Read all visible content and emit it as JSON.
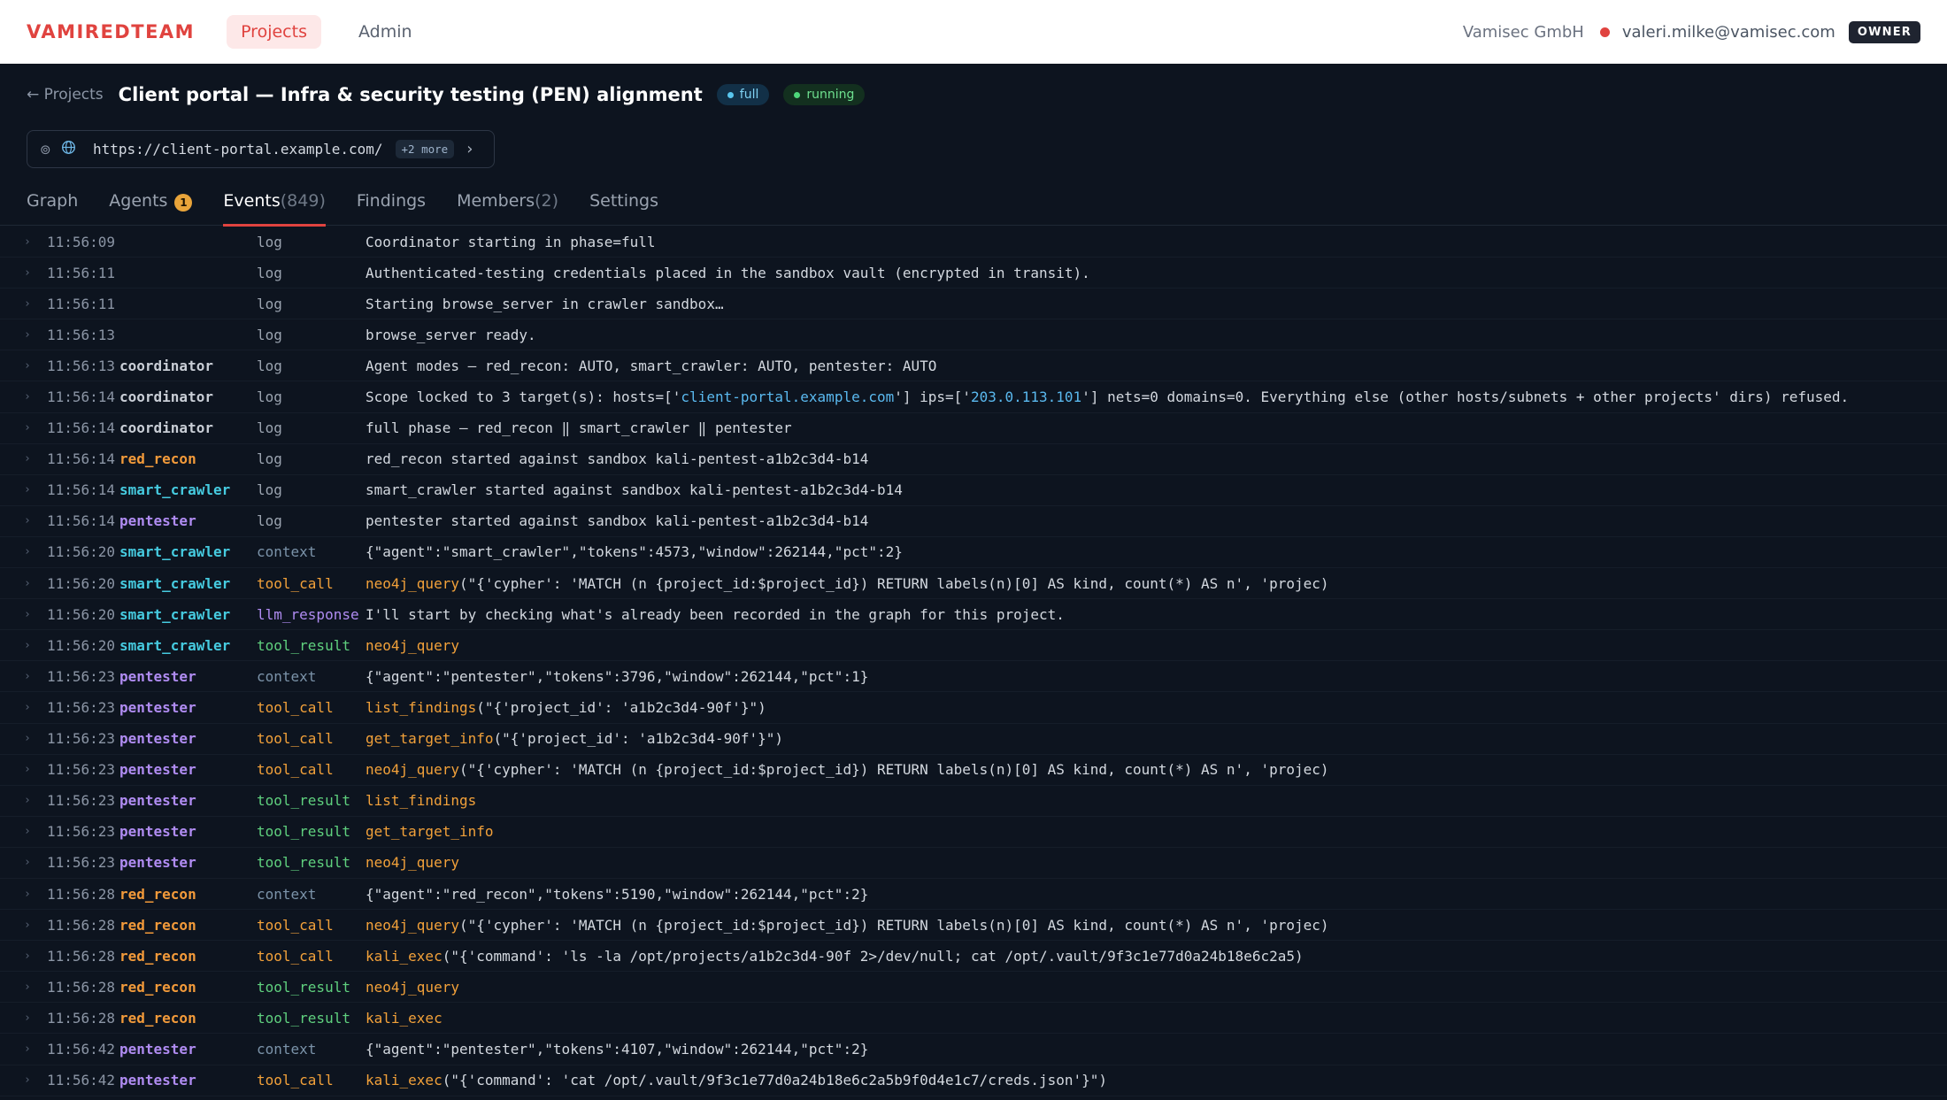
{
  "nav": {
    "brand": "VAMIREDTEAM",
    "projects": "Projects",
    "admin": "Admin",
    "org": "Vamisec GmbH",
    "email": "valeri.milke@vamisec.com",
    "role": "OWNER"
  },
  "header": {
    "back": "← Projects",
    "title": "Client portal — Infra & security testing (PEN) alignment",
    "phase_badge": "full",
    "status_badge": "running"
  },
  "target": {
    "url": "https://client-portal.example.com/",
    "more": "+2 more",
    "chevron": "›"
  },
  "tabs": {
    "graph": "Graph",
    "agents": "Agents",
    "agents_badge": "1",
    "events": "Events",
    "events_count": "(849)",
    "findings": "Findings",
    "members": "Members",
    "members_count": "(2)",
    "settings": "Settings"
  },
  "colors": {
    "accent": "#e0433f",
    "red_recon": "#f29a3a",
    "smart_crawler": "#46cbe0",
    "pentester": "#b08cf2"
  },
  "events": [
    {
      "time": "11:56:09",
      "agent": "",
      "type": "log",
      "msg": "Coordinator starting in phase=full"
    },
    {
      "time": "11:56:11",
      "agent": "",
      "type": "log",
      "msg": "Authenticated-testing credentials placed in the sandbox vault (encrypted in transit)."
    },
    {
      "time": "11:56:11",
      "agent": "",
      "type": "log",
      "msg": "Starting browse_server in crawler sandbox…"
    },
    {
      "time": "11:56:13",
      "agent": "",
      "type": "log",
      "msg": "browse_server ready."
    },
    {
      "time": "11:56:13",
      "agent": "coordinator",
      "type": "log",
      "msg": "Agent modes — red_recon: AUTO, smart_crawler: AUTO, pentester: AUTO"
    },
    {
      "time": "11:56:14",
      "agent": "coordinator",
      "type": "log",
      "msg_parts": [
        "Scope locked to 3 target(s): hosts=['",
        "client-portal.example.com",
        "'] ips=['",
        "203.0.113.101",
        "'] nets=0 domains=0. Everything else (other hosts/subnets + other projects' dirs) refused."
      ]
    },
    {
      "time": "11:56:14",
      "agent": "coordinator",
      "type": "log",
      "msg": "full phase — red_recon ‖ smart_crawler ‖ pentester"
    },
    {
      "time": "11:56:14",
      "agent": "red_recon",
      "type": "log",
      "msg": "red_recon started against sandbox kali-pentest-a1b2c3d4-b14"
    },
    {
      "time": "11:56:14",
      "agent": "smart_crawler",
      "type": "log",
      "msg": "smart_crawler started against sandbox kali-pentest-a1b2c3d4-b14"
    },
    {
      "time": "11:56:14",
      "agent": "pentester",
      "type": "log",
      "msg": "pentester started against sandbox kali-pentest-a1b2c3d4-b14"
    },
    {
      "time": "11:56:20",
      "agent": "smart_crawler",
      "type": "context",
      "msg": "{\"agent\":\"smart_crawler\",\"tokens\":4573,\"window\":262144,\"pct\":2}"
    },
    {
      "time": "11:56:20",
      "agent": "smart_crawler",
      "type": "tool_call",
      "fn": "neo4j_query",
      "args": "(\"{'cypher': 'MATCH (n {project_id:$project_id}) RETURN labels(n)[0] AS kind, count(*) AS n', 'projec)"
    },
    {
      "time": "11:56:20",
      "agent": "smart_crawler",
      "type": "llm_response",
      "msg": "I'll start by checking what's already been recorded in the graph for this project."
    },
    {
      "time": "11:56:20",
      "agent": "smart_crawler",
      "type": "tool_result",
      "fn": "neo4j_query",
      "args": ""
    },
    {
      "time": "11:56:23",
      "agent": "pentester",
      "type": "context",
      "msg": "{\"agent\":\"pentester\",\"tokens\":3796,\"window\":262144,\"pct\":1}"
    },
    {
      "time": "11:56:23",
      "agent": "pentester",
      "type": "tool_call",
      "fn": "list_findings",
      "args": "(\"{'project_id': 'a1b2c3d4-90f'}\")"
    },
    {
      "time": "11:56:23",
      "agent": "pentester",
      "type": "tool_call",
      "fn": "get_target_info",
      "args": "(\"{'project_id': 'a1b2c3d4-90f'}\")"
    },
    {
      "time": "11:56:23",
      "agent": "pentester",
      "type": "tool_call",
      "fn": "neo4j_query",
      "args": "(\"{'cypher': 'MATCH (n {project_id:$project_id}) RETURN labels(n)[0] AS kind, count(*) AS n', 'projec)"
    },
    {
      "time": "11:56:23",
      "agent": "pentester",
      "type": "tool_result",
      "fn": "list_findings",
      "args": ""
    },
    {
      "time": "11:56:23",
      "agent": "pentester",
      "type": "tool_result",
      "fn": "get_target_info",
      "args": ""
    },
    {
      "time": "11:56:23",
      "agent": "pentester",
      "type": "tool_result",
      "fn": "neo4j_query",
      "args": ""
    },
    {
      "time": "11:56:28",
      "agent": "red_recon",
      "type": "context",
      "msg": "{\"agent\":\"red_recon\",\"tokens\":5190,\"window\":262144,\"pct\":2}"
    },
    {
      "time": "11:56:28",
      "agent": "red_recon",
      "type": "tool_call",
      "fn": "neo4j_query",
      "args": "(\"{'cypher': 'MATCH (n {project_id:$project_id}) RETURN labels(n)[0] AS kind, count(*) AS n', 'projec)"
    },
    {
      "time": "11:56:28",
      "agent": "red_recon",
      "type": "tool_call",
      "fn": "kali_exec",
      "args": "(\"{'command': 'ls -la /opt/projects/a1b2c3d4-90f 2>/dev/null; cat /opt/.vault/9f3c1e77d0a24b18e6c2a5)"
    },
    {
      "time": "11:56:28",
      "agent": "red_recon",
      "type": "tool_result",
      "fn": "neo4j_query",
      "args": ""
    },
    {
      "time": "11:56:28",
      "agent": "red_recon",
      "type": "tool_result",
      "fn": "kali_exec",
      "args": ""
    },
    {
      "time": "11:56:42",
      "agent": "pentester",
      "type": "context",
      "msg": "{\"agent\":\"pentester\",\"tokens\":4107,\"window\":262144,\"pct\":2}"
    },
    {
      "time": "11:56:42",
      "agent": "pentester",
      "type": "tool_call",
      "fn": "kali_exec",
      "args": "(\"{'command': 'cat /opt/.vault/9f3c1e77d0a24b18e6c2a5b9f0d4e1c7/creds.json'}\")"
    }
  ]
}
